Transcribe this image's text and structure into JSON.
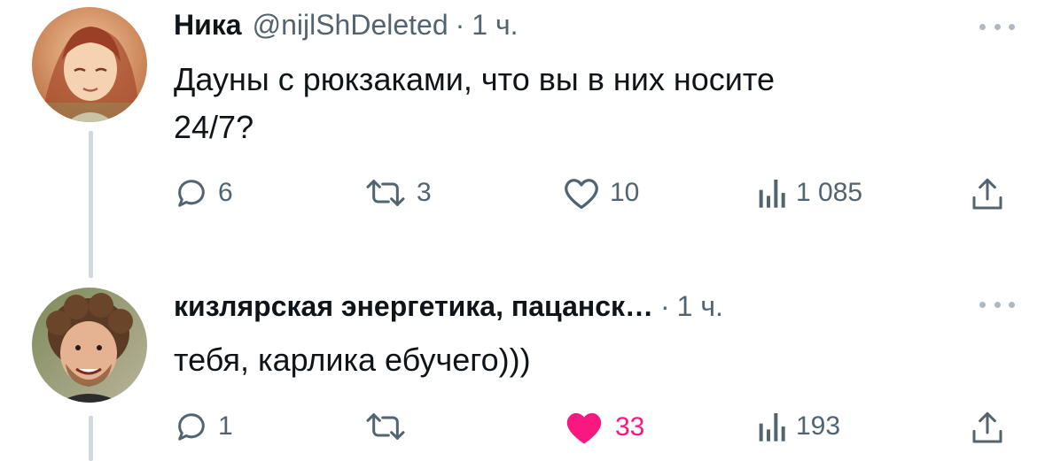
{
  "tweets": [
    {
      "name": "Ника",
      "handle": "@nijlShDeleted",
      "dot": "·",
      "time": "1 ч.",
      "text_lines": [
        "Дауны с рюкзаками, что вы в них носите",
        "24/7?"
      ],
      "replies": "6",
      "retweets": "3",
      "likes": "10",
      "views": "1 085",
      "liked": false
    },
    {
      "name": "кизлярская энергетика, пацанск…",
      "dot": "·",
      "time": "1 ч.",
      "text_lines": [
        "тебя, карлика ебучего)))"
      ],
      "replies": "1",
      "retweets": "",
      "likes": "33",
      "views": "193",
      "liked": true
    }
  ],
  "icons": {
    "reply": "reply-icon",
    "retweet": "retweet-icon",
    "like": "heart-icon",
    "views": "views-chart-icon",
    "share": "share-icon",
    "more": "more-dots-icon"
  },
  "colors": {
    "text": "#0f1419",
    "secondary": "#536471",
    "like_active": "#f91880",
    "thread_line": "#cfd9de"
  }
}
